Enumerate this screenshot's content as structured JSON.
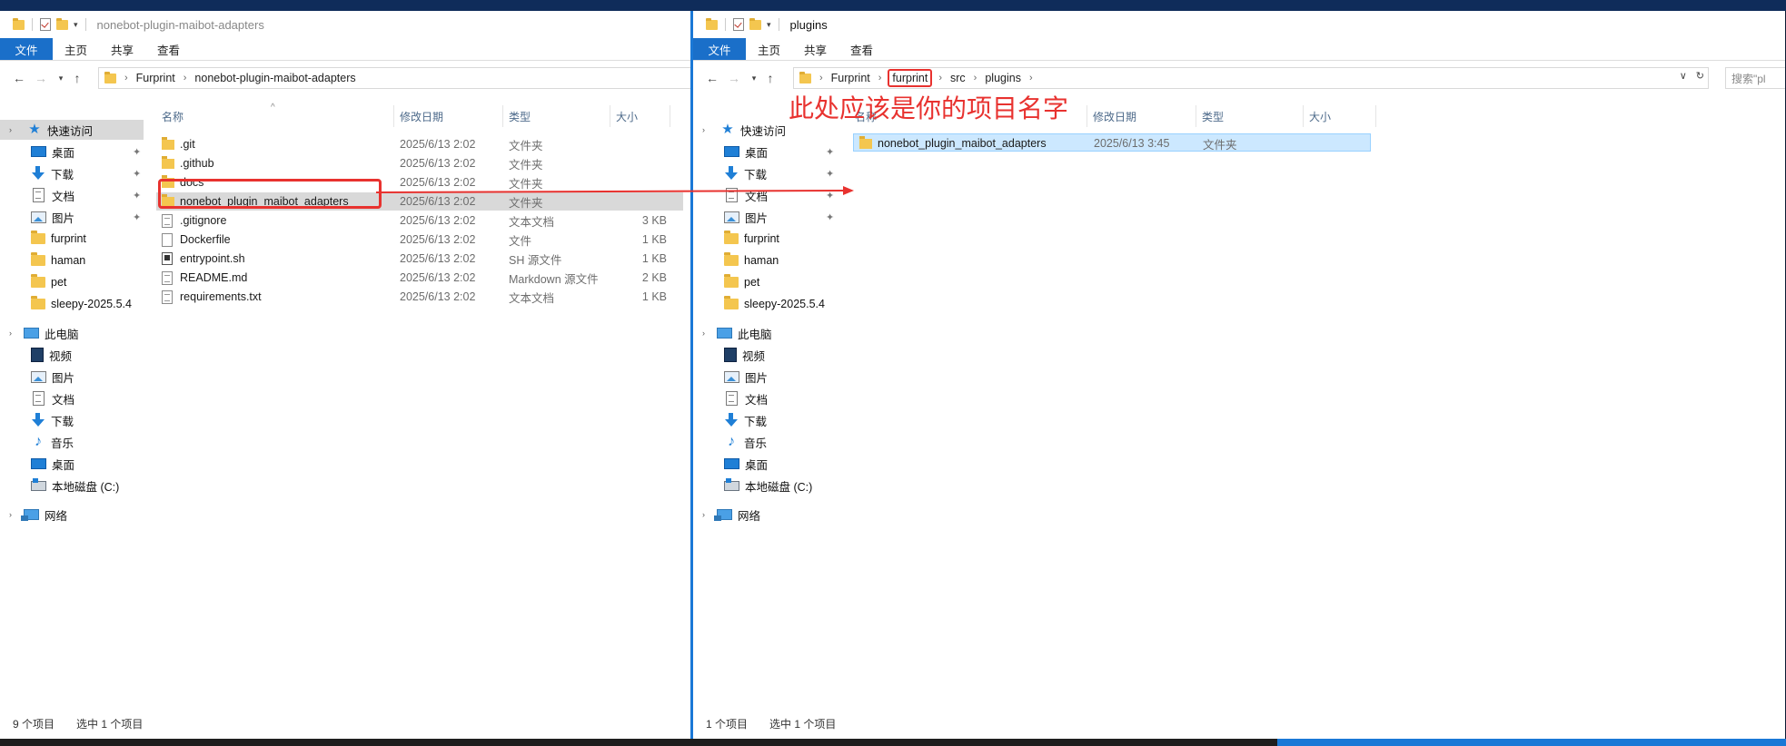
{
  "left": {
    "title": "nonebot-plugin-maibot-adapters",
    "ribbon": [
      "文件",
      "主页",
      "共享",
      "查看"
    ],
    "breadcrumb": [
      "Furprint",
      "nonebot-plugin-maibot-adapters"
    ],
    "columns": {
      "name": "名称",
      "date": "修改日期",
      "type": "类型",
      "size": "大小"
    },
    "files": [
      {
        "name": ".git",
        "date": "2025/6/13 2:02",
        "type": "文件夹",
        "size": "",
        "icon": "folder"
      },
      {
        "name": ".github",
        "date": "2025/6/13 2:02",
        "type": "文件夹",
        "size": "",
        "icon": "folder"
      },
      {
        "name": "docs",
        "date": "2025/6/13 2:02",
        "type": "文件夹",
        "size": "",
        "icon": "folder"
      },
      {
        "name": "nonebot_plugin_maibot_adapters",
        "date": "2025/6/13 2:02",
        "type": "文件夹",
        "size": "",
        "icon": "folder"
      },
      {
        "name": ".gitignore",
        "date": "2025/6/13 2:02",
        "type": "文本文档",
        "size": "3 KB",
        "icon": "text"
      },
      {
        "name": "Dockerfile",
        "date": "2025/6/13 2:02",
        "type": "文件",
        "size": "1 KB",
        "icon": "file"
      },
      {
        "name": "entrypoint.sh",
        "date": "2025/6/13 2:02",
        "type": "SH 源文件",
        "size": "1 KB",
        "icon": "script"
      },
      {
        "name": "README.md",
        "date": "2025/6/13 2:02",
        "type": "Markdown 源文件",
        "size": "2 KB",
        "icon": "text"
      },
      {
        "name": "requirements.txt",
        "date": "2025/6/13 2:02",
        "type": "文本文档",
        "size": "1 KB",
        "icon": "text"
      }
    ],
    "status": {
      "count": "9 个项目",
      "selected": "选中 1 个项目"
    }
  },
  "right": {
    "title": "plugins",
    "ribbon": [
      "文件",
      "主页",
      "共享",
      "查看"
    ],
    "breadcrumb": [
      "Furprint",
      "furprint",
      "src",
      "plugins"
    ],
    "search_placeholder": "搜索\"pl",
    "columns": {
      "name": "名称",
      "date": "修改日期",
      "type": "类型",
      "size": "大小"
    },
    "files": [
      {
        "name": "nonebot_plugin_maibot_adapters",
        "date": "2025/6/13 3:45",
        "type": "文件夹",
        "size": "",
        "icon": "folder"
      }
    ],
    "status": {
      "count": "1 个项目",
      "selected": "选中 1 个项目"
    }
  },
  "sidebar": {
    "quick_access": "快速访问",
    "quick_items": [
      {
        "label": "桌面",
        "icon": "desktop",
        "pinned": true
      },
      {
        "label": "下载",
        "icon": "down",
        "pinned": true
      },
      {
        "label": "文档",
        "icon": "doc",
        "pinned": true
      },
      {
        "label": "图片",
        "icon": "pic",
        "pinned": true
      },
      {
        "label": "furprint",
        "icon": "folder",
        "pinned": false
      },
      {
        "label": "haman",
        "icon": "folder",
        "pinned": false
      },
      {
        "label": "pet",
        "icon": "folder",
        "pinned": false
      },
      {
        "label": "sleepy-2025.5.4",
        "icon": "folder",
        "pinned": false
      }
    ],
    "this_pc": "此电脑",
    "pc_items": [
      {
        "label": "视频",
        "icon": "video"
      },
      {
        "label": "图片",
        "icon": "pic"
      },
      {
        "label": "文档",
        "icon": "doc"
      },
      {
        "label": "下载",
        "icon": "down"
      },
      {
        "label": "音乐",
        "icon": "music"
      },
      {
        "label": "桌面",
        "icon": "desktop"
      },
      {
        "label": "本地磁盘 (C:)",
        "icon": "disk"
      }
    ],
    "network": "网络"
  },
  "annotation": {
    "text": "此处应该是你的项目名字",
    "color": "#e8322f"
  }
}
